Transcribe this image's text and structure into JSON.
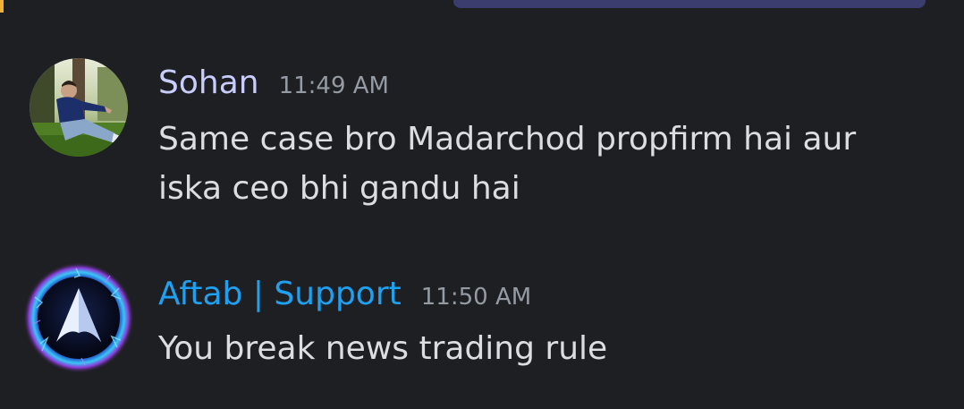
{
  "messages": [
    {
      "author": "Sohan",
      "author_color": "#c9cdfb",
      "timestamp": "11:49 AM",
      "text": "Same case bro Madarchod propfirm hai aur\niska ceo bhi gandu hai",
      "avatar_icon": "user-photo-avatar"
    },
    {
      "author": "Aftab | Support",
      "author_color": "#1fa1f1",
      "timestamp": "11:50 AM",
      "text": "You break news trading rule",
      "avatar_icon": "logo-a-avatar"
    }
  ]
}
